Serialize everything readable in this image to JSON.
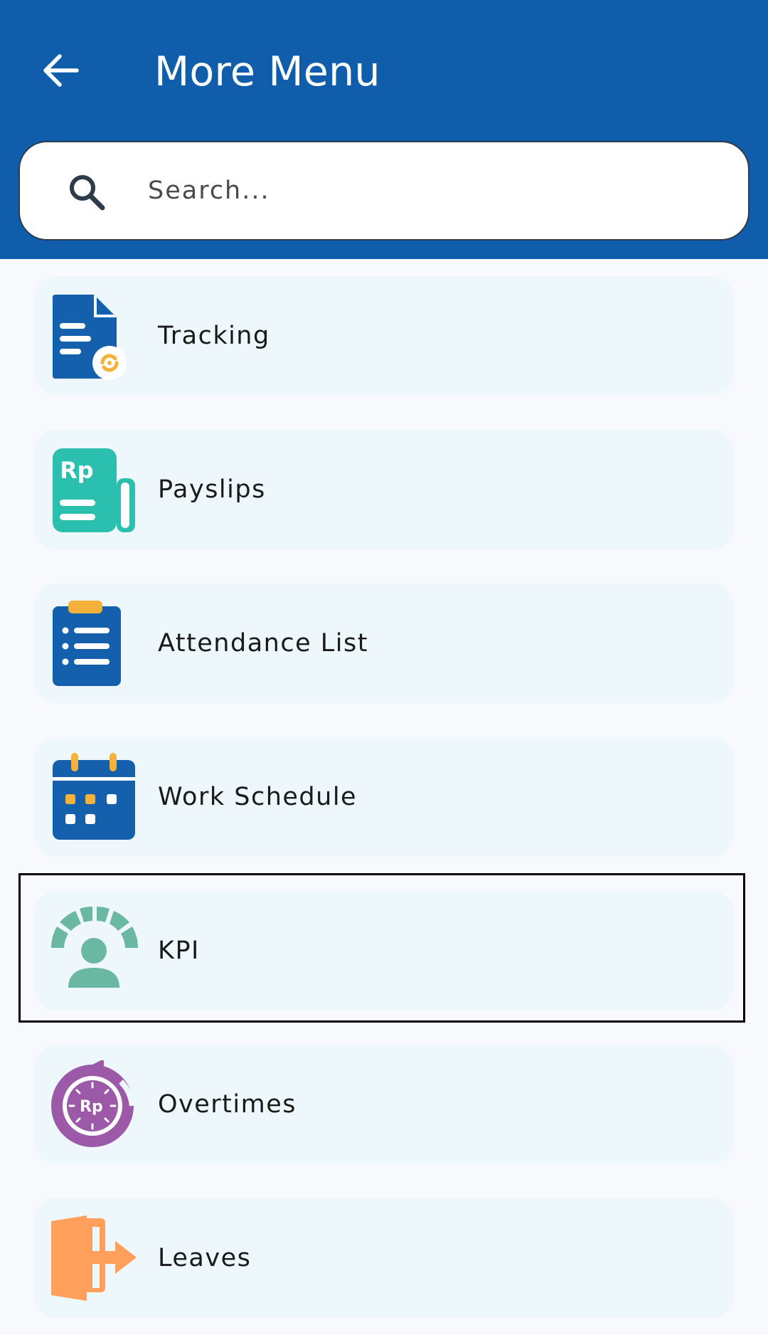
{
  "header": {
    "title": "More Menu",
    "back_icon": "arrow-left-icon",
    "background_color": "#0f5dab"
  },
  "search": {
    "placeholder": "Search...",
    "value": "",
    "icon": "search-icon"
  },
  "menu": {
    "items": [
      {
        "label": "Tracking",
        "icon": "document-sync-icon",
        "color": "#1560ad"
      },
      {
        "label": "Payslips",
        "icon": "payslip-rp-icon",
        "color": "#2bbfb0"
      },
      {
        "label": "Attendance List",
        "icon": "clipboard-list-icon",
        "color": "#1560ad"
      },
      {
        "label": "Work Schedule",
        "icon": "calendar-icon",
        "color": "#1560ad"
      },
      {
        "label": "KPI",
        "icon": "kpi-person-gauge-icon",
        "color": "#6bb8a2"
      },
      {
        "label": "Overtimes",
        "icon": "overtime-clock-rp-icon",
        "color": "#9b59a8"
      },
      {
        "label": "Leaves",
        "icon": "exit-door-icon",
        "color": "#ff9f5c"
      }
    ],
    "item_background": "#eef8fc",
    "focused_item": "KPI"
  }
}
